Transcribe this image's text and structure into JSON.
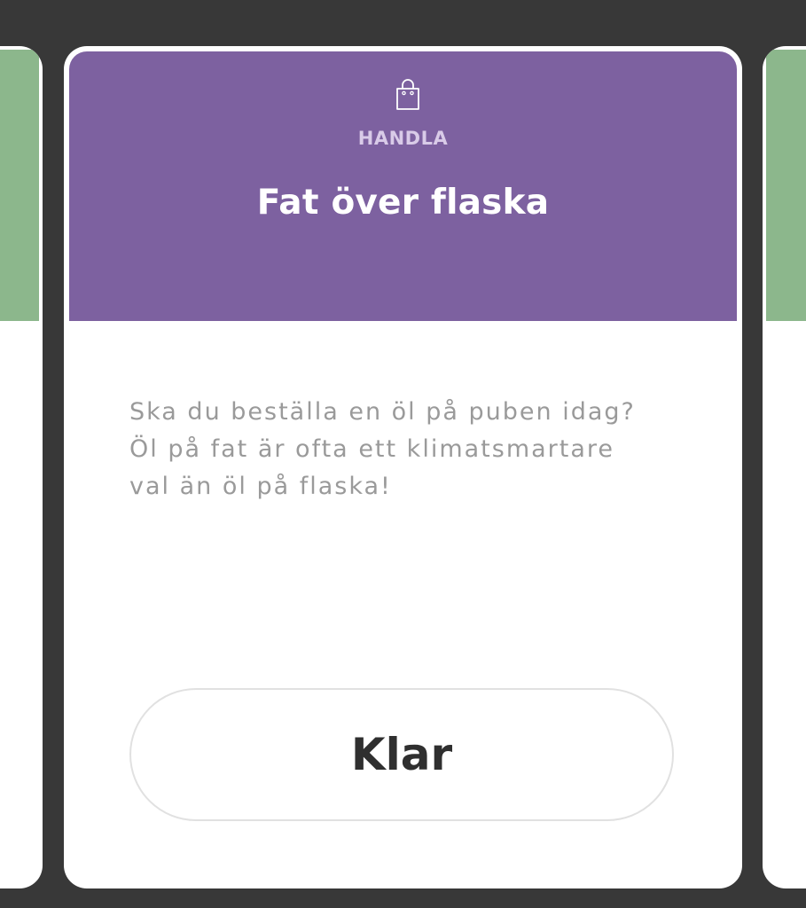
{
  "colors": {
    "background": "#383838",
    "main_header": "#7d61a0",
    "side_header": "#8cb78c",
    "category_text": "#d9cbe8"
  },
  "main_card": {
    "icon": "shopping-bag-icon",
    "category": "HANDLA",
    "title": "Fat över flaska",
    "description": "Ska du beställa en öl på puben idag?\nÖl på fat är ofta ett klimatsmartare\nval än öl på flaska!",
    "button_label": "Klar"
  }
}
